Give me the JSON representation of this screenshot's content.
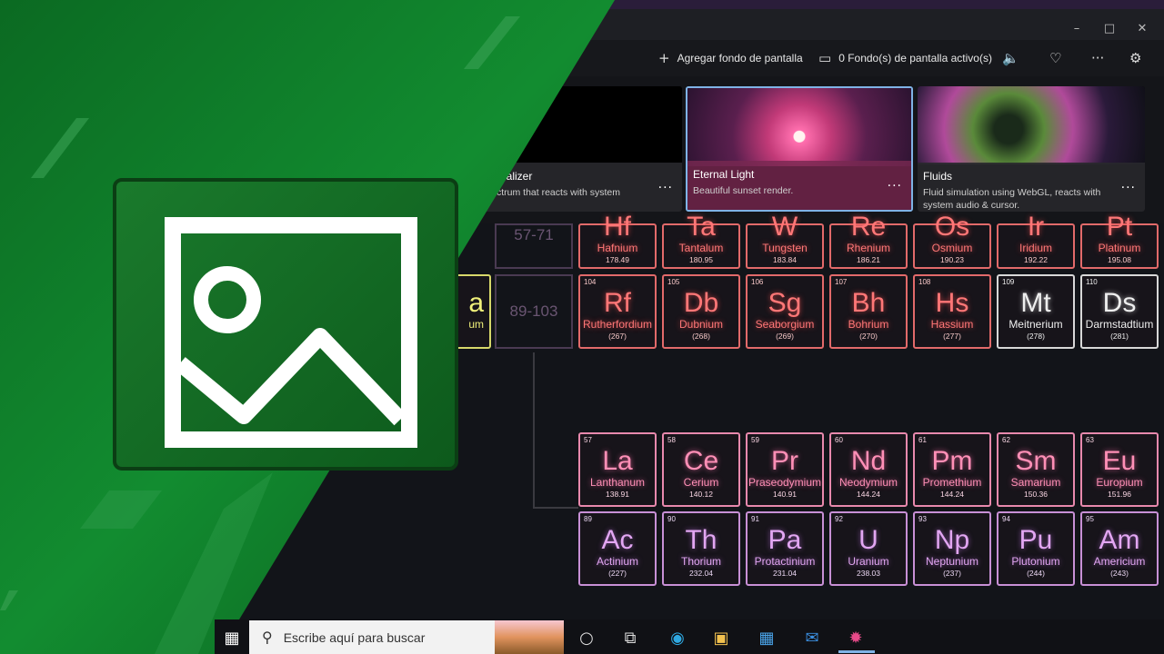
{
  "window": {
    "minimize_icon": "minimize-icon",
    "maximize_icon": "maximize-icon",
    "close_icon": "close-icon"
  },
  "toolbar": {
    "add_wallpaper": "Agregar fondo de pantalla",
    "active_wallpapers": "0 Fondo(s) de pantalla activo(s)",
    "icons": [
      "plus-icon",
      "monitor-icon",
      "volume-icon",
      "heart-icon",
      "more-icon",
      "gear-icon"
    ]
  },
  "cards": [
    {
      "name": "ualizer",
      "desc": "ctrum that reacts with system"
    },
    {
      "name": "Eternal Light",
      "desc": "Beautiful sunset render."
    },
    {
      "name": "Fluids",
      "desc": "Fluid simulation using WebGL, reacts with system audio & cursor."
    }
  ],
  "periodic": {
    "row6": [
      {
        "sym": "Hf",
        "name": "Hafnium",
        "mass": "178.49"
      },
      {
        "sym": "Ta",
        "name": "Tantalum",
        "mass": "180.95"
      },
      {
        "sym": "W",
        "name": "Tungsten",
        "mass": "183.84"
      },
      {
        "sym": "Re",
        "name": "Rhenium",
        "mass": "186.21"
      },
      {
        "sym": "Os",
        "name": "Osmium",
        "mass": "190.23"
      },
      {
        "sym": "Ir",
        "name": "Iridium",
        "mass": "192.22"
      },
      {
        "sym": "Pt",
        "name": "Platinum",
        "mass": "195.08"
      }
    ],
    "row7": [
      {
        "num": "104",
        "sym": "Rf",
        "name": "Rutherfordium",
        "mass": "(267)"
      },
      {
        "num": "105",
        "sym": "Db",
        "name": "Dubnium",
        "mass": "(268)"
      },
      {
        "num": "106",
        "sym": "Sg",
        "name": "Seaborgium",
        "mass": "(269)"
      },
      {
        "num": "107",
        "sym": "Bh",
        "name": "Bohrium",
        "mass": "(270)"
      },
      {
        "num": "108",
        "sym": "Hs",
        "name": "Hassium",
        "mass": "(277)"
      },
      {
        "num": "109",
        "sym": "Mt",
        "name": "Meitnerium",
        "mass": "(278)"
      },
      {
        "num": "110",
        "sym": "Ds",
        "name": "Darmstadtium",
        "mass": "(281)"
      }
    ],
    "ranges": [
      "57-71",
      "89-103"
    ],
    "partial": {
      "sym": "a",
      "name": "um"
    },
    "lanthanides": [
      {
        "num": "57",
        "sym": "La",
        "name": "Lanthanum",
        "mass": "138.91"
      },
      {
        "num": "58",
        "sym": "Ce",
        "name": "Cerium",
        "mass": "140.12"
      },
      {
        "num": "59",
        "sym": "Pr",
        "name": "Praseodymium",
        "mass": "140.91"
      },
      {
        "num": "60",
        "sym": "Nd",
        "name": "Neodymium",
        "mass": "144.24"
      },
      {
        "num": "61",
        "sym": "Pm",
        "name": "Promethium",
        "mass": "144.24"
      },
      {
        "num": "62",
        "sym": "Sm",
        "name": "Samarium",
        "mass": "150.36"
      },
      {
        "num": "63",
        "sym": "Eu",
        "name": "Europium",
        "mass": "151.96"
      }
    ],
    "actinides": [
      {
        "num": "89",
        "sym": "Ac",
        "name": "Actinium",
        "mass": "(227)"
      },
      {
        "num": "90",
        "sym": "Th",
        "name": "Thorium",
        "mass": "232.04"
      },
      {
        "num": "91",
        "sym": "Pa",
        "name": "Protactinium",
        "mass": "231.04"
      },
      {
        "num": "92",
        "sym": "U",
        "name": "Uranium",
        "mass": "238.03"
      },
      {
        "num": "93",
        "sym": "Np",
        "name": "Neptunium",
        "mass": "(237)"
      },
      {
        "num": "94",
        "sym": "Pu",
        "name": "Plutonium",
        "mass": "(244)"
      },
      {
        "num": "95",
        "sym": "Am",
        "name": "Americium",
        "mass": "(243)"
      }
    ]
  },
  "taskbar": {
    "search_placeholder": "Escribe aquí para buscar",
    "icons": [
      "search-icon",
      "cortana-icon",
      "task-view-icon",
      "edge-icon",
      "file-explorer-icon",
      "store-icon",
      "mail-icon",
      "lively-icon"
    ]
  },
  "colors": {
    "brand_green": "#118a2e",
    "accent_border": "#7fb3e6"
  }
}
